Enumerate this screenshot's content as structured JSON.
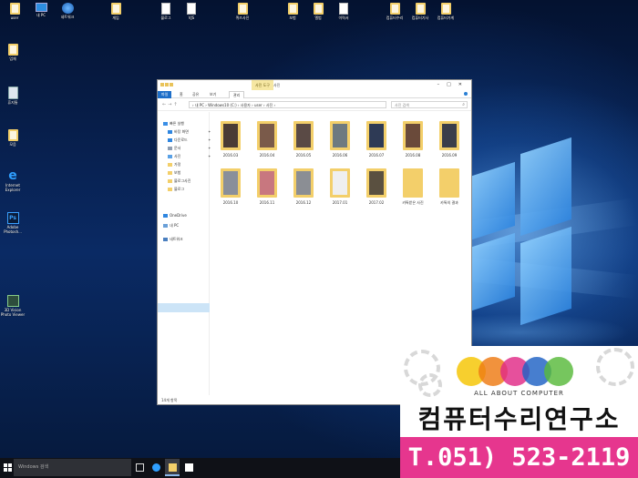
{
  "desktop": {
    "icons_top": [
      {
        "label": "user",
        "icon": "user-folder-icon"
      },
      {
        "label": "내 PC",
        "icon": "this-pc-icon"
      },
      {
        "label": "네트워크",
        "icon": "network-icon"
      },
      {
        "label": "게임",
        "icon": "folder-icon"
      },
      {
        "label": "블로그",
        "icon": "document-icon"
      },
      {
        "label": "VJS",
        "icon": "document-icon"
      },
      {
        "label": "퀴즈사진",
        "icon": "folder-icon"
      },
      {
        "label": "보험",
        "icon": "folder-icon"
      },
      {
        "label": "엘범",
        "icon": "folder-icon"
      },
      {
        "label": "이력서",
        "icon": "document-icon"
      },
      {
        "label": "컴퓨터수리",
        "icon": "folder-icon"
      },
      {
        "label": "컴퓨터기사",
        "icon": "folder-icon"
      },
      {
        "label": "컴퓨터가게",
        "icon": "folder-icon"
      }
    ],
    "icons_left": [
      {
        "label": "업체",
        "icon": "folder-icon"
      },
      {
        "label": "휴지통",
        "icon": "recycle-bin-icon"
      },
      {
        "label": "모음",
        "icon": "folder-icon"
      },
      {
        "label": "Internet Explorer",
        "icon": "internet-explorer-icon"
      },
      {
        "label": "Adobe Photosh...",
        "icon": "photoshop-icon"
      },
      {
        "label": "3D Vision Photo Viewer",
        "icon": "3d-vision-icon"
      }
    ]
  },
  "explorer": {
    "context_tab": "사진 도구",
    "context_tab2": "사진",
    "ribbon_tabs": [
      "파일",
      "홈",
      "공유",
      "보기",
      "관리"
    ],
    "address": "›  내 PC  ›  Windows10 (C:)  ›  사용자  ›  user  ›  사진  ›",
    "search_placeholder": "사진 검색",
    "nav_items": [
      {
        "label": "빠른 실행"
      },
      {
        "label": "바탕 화면"
      },
      {
        "label": "다운로드"
      },
      {
        "label": "문서"
      },
      {
        "label": "사진"
      },
      {
        "label": "가정"
      },
      {
        "label": "보험"
      },
      {
        "label": "블로그사진"
      },
      {
        "label": "블로그"
      },
      {
        "label": "OneDrive"
      },
      {
        "label": "내 PC"
      },
      {
        "label": "네트워크"
      }
    ],
    "folders": [
      {
        "name": "2016.03",
        "photo_color": "#4a3b35"
      },
      {
        "name": "2016.04",
        "photo_color": "#7a5a4a"
      },
      {
        "name": "2016.05",
        "photo_color": "#5a4a45"
      },
      {
        "name": "2016.06",
        "photo_color": "#6e7a80"
      },
      {
        "name": "2016.07",
        "photo_color": "#2e3a55"
      },
      {
        "name": "2016.08",
        "photo_color": "#6a4a3a"
      },
      {
        "name": "2016.09",
        "photo_color": "#3a3d4a"
      },
      {
        "name": "2016.10",
        "photo_color": "#8a8f9a"
      },
      {
        "name": "2016.11",
        "photo_color": "#c8777f"
      },
      {
        "name": "2016.12",
        "photo_color": "#8b8e94"
      },
      {
        "name": "2017.01",
        "photo_color": "#efefef"
      },
      {
        "name": "2017.02",
        "photo_color": "#5a5040"
      },
      {
        "name": "카톡받은 사진",
        "photo_color": "#f3cf6a"
      },
      {
        "name": "카톡의 결과",
        "photo_color": "#f3cf6a"
      }
    ],
    "status": "14개 항목"
  },
  "taskbar": {
    "search_placeholder": "Windows 검색"
  },
  "ad": {
    "tagline": "ALL ABOUT COMPUTER",
    "name": "컴퓨터수리연구소",
    "phone": "T.051) 523-2119",
    "circle_colors": [
      "#f5c400",
      "#ee7a12",
      "#e02a86",
      "#1f62c4",
      "#58b93a"
    ]
  }
}
